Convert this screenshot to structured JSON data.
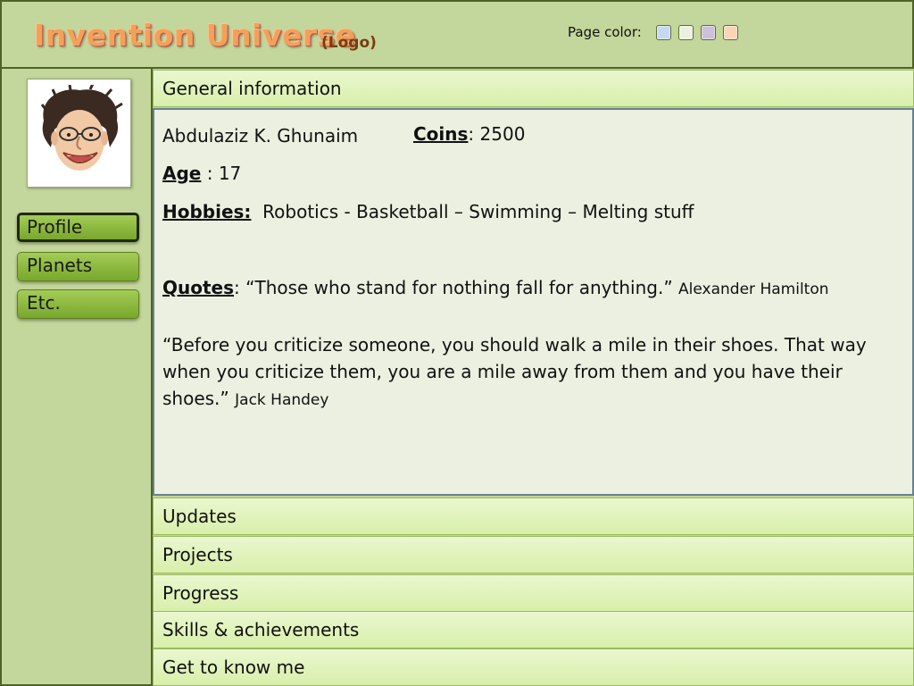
{
  "header": {
    "logo_text": "Invention Universe",
    "logo_sub": "(Logo)",
    "page_color_label": "Page color:",
    "swatches": [
      {
        "name": "blue",
        "color": "#c6d9f1"
      },
      {
        "name": "green",
        "color": "#ebf1dd"
      },
      {
        "name": "purple",
        "color": "#ccc0da"
      },
      {
        "name": "orange",
        "color": "#fbd4b4"
      }
    ]
  },
  "sidebar": {
    "avatar": "caricature-portrait",
    "items": [
      {
        "label": "Profile",
        "active": true
      },
      {
        "label": "Planets",
        "active": false
      },
      {
        "label": "Etc.",
        "active": false
      }
    ]
  },
  "sections": {
    "general": "General information",
    "updates": "Updates",
    "projects": "Projects",
    "progress": "Progress",
    "skills": "Skills & achievements",
    "know_me": "Get to know me"
  },
  "profile": {
    "name": "Abdulaziz K. Ghunaim",
    "coins_label": "Coins",
    "coins_value": ": 2500",
    "age_label": "Age",
    "age_value": " : 17",
    "hobbies_label": "Hobbies:",
    "hobbies_value": "Robotics - Basketball – Swimming – Melting stuff",
    "quotes_label": "Quotes",
    "quote1_text": ": “Those who stand for nothing fall for anything.”",
    "quote1_author": "Alexander Hamilton",
    "quote2_text": "“Before you criticize someone, you should walk a mile in their shoes. That way when you criticize them, you are a mile away from them and you have their shoes.”",
    "quote2_author": "Jack Handey"
  }
}
